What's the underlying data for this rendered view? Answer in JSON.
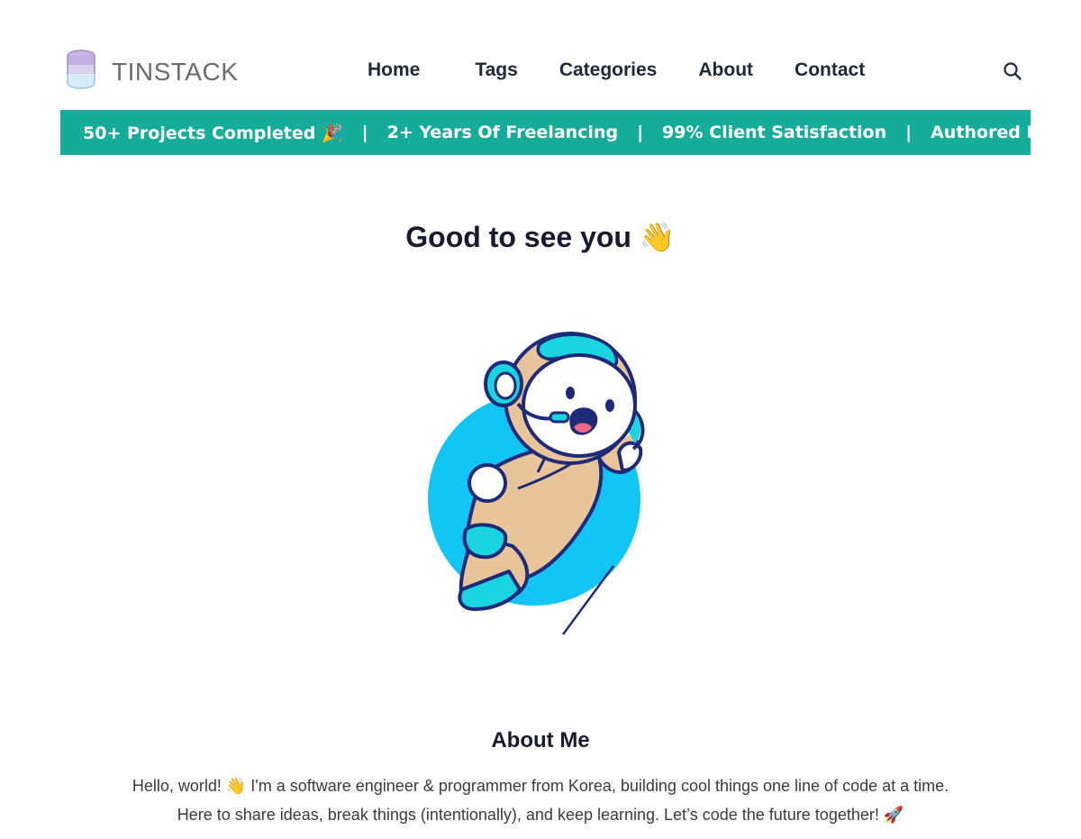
{
  "header": {
    "logo_text": "TINSTACK",
    "logo_icon": "database-icon",
    "nav": [
      "Home",
      "Tags",
      "Categories",
      "About",
      "Contact"
    ],
    "search_icon": "search-icon"
  },
  "ticker": {
    "items": [
      "50+ Projects Completed 🎉",
      "2+ Years Of Freelancing",
      "99% Client Satisfaction",
      "Authored In-Depth"
    ],
    "separator": "|",
    "bg_color": "#15ad9a"
  },
  "hero": {
    "greeting": "Good to see you 👋",
    "illustration": "astronaut-illustration"
  },
  "about": {
    "title": "About Me",
    "line1": "Hello, world! 👋 I'm a software engineer & programmer from Korea, building cool things one line of code at a time.",
    "line2": "Here to share ideas, break things (intentionally), and keep learning. Let’s code the future together! 🚀"
  },
  "colors": {
    "accent": "#15ad9a",
    "astronaut_cyan": "#1ad4e0",
    "circle_blue": "#12c5f5",
    "suit_tan": "#e8c49a",
    "outline": "#1e2a78"
  }
}
